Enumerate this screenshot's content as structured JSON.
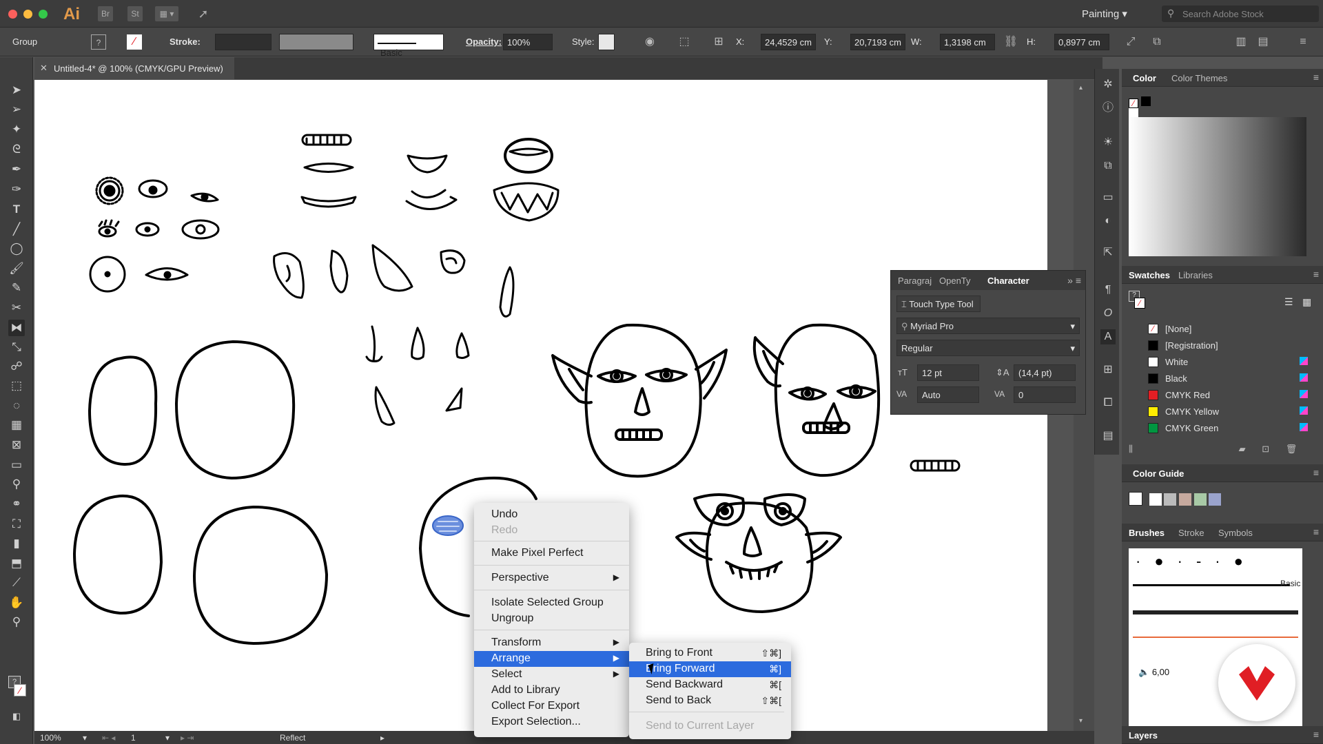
{
  "app": {
    "logo": "Ai",
    "workspace": "Painting",
    "search_placeholder": "Search Adobe Stock",
    "bridge_label": "Br",
    "stock_label": "St"
  },
  "controlbar": {
    "selection_type": "Group",
    "stroke_label": "Stroke:",
    "brush_label": "Basic",
    "opacity_label": "Opacity:",
    "opacity_value": "100%",
    "style_label": "Style:",
    "x_label": "X:",
    "x_value": "24,4529 cm",
    "y_label": "Y:",
    "y_value": "20,7193 cm",
    "w_label": "W:",
    "w_value": "1,3198 cm",
    "h_label": "H:",
    "h_value": "0,8977 cm"
  },
  "document": {
    "tab_title": "Untitled-4* @ 100% (CMYK/GPU Preview)"
  },
  "statusbar": {
    "zoom": "100%",
    "artboard": "1",
    "tool": "Reflect"
  },
  "character_panel": {
    "tabs": [
      "Paragraj",
      "OpenTy",
      "Character"
    ],
    "touch_type": "Touch Type Tool",
    "font_family": "Myriad Pro",
    "font_style": "Regular",
    "font_size": "12 pt",
    "leading": "(14,4 pt)",
    "kerning": "Auto",
    "tracking": "0"
  },
  "color_panel": {
    "tabs": [
      "Color",
      "Color Themes"
    ]
  },
  "swatches_panel": {
    "tabs": [
      "Swatches",
      "Libraries"
    ],
    "items": [
      {
        "name": "[None]",
        "color": "none"
      },
      {
        "name": "[Registration]",
        "color": "#000000"
      },
      {
        "name": "White",
        "color": "#ffffff"
      },
      {
        "name": "Black",
        "color": "#000000"
      },
      {
        "name": "CMYK Red",
        "color": "#e31e24"
      },
      {
        "name": "CMYK Yellow",
        "color": "#ffed00"
      },
      {
        "name": "CMYK Green",
        "color": "#009640"
      }
    ]
  },
  "color_guide": {
    "title": "Color Guide"
  },
  "brushes_panel": {
    "tabs": [
      "Brushes",
      "Stroke",
      "Symbols"
    ],
    "basic_label": "Basic",
    "size_value": "6,00"
  },
  "layers_panel": {
    "title": "Layers"
  },
  "context_menu": {
    "items": [
      {
        "label": "Undo",
        "enabled": true
      },
      {
        "label": "Redo",
        "enabled": false
      },
      {
        "label": "Make Pixel Perfect",
        "enabled": true
      },
      {
        "label": "Perspective",
        "enabled": true,
        "submenu": true
      },
      {
        "label": "Isolate Selected Group",
        "enabled": true
      },
      {
        "label": "Ungroup",
        "enabled": true
      },
      {
        "label": "Transform",
        "enabled": true,
        "submenu": true
      },
      {
        "label": "Arrange",
        "enabled": true,
        "submenu": true,
        "highlighted": true
      },
      {
        "label": "Select",
        "enabled": true,
        "submenu": true
      },
      {
        "label": "Add to Library",
        "enabled": true
      },
      {
        "label": "Collect For Export",
        "enabled": true
      },
      {
        "label": "Export Selection...",
        "enabled": true
      }
    ]
  },
  "arrange_submenu": {
    "items": [
      {
        "label": "Bring to Front",
        "shortcut": "⇧⌘]",
        "enabled": true
      },
      {
        "label": "Bring Forward",
        "shortcut": "⌘]",
        "enabled": true,
        "highlighted": true
      },
      {
        "label": "Send Backward",
        "shortcut": "⌘[",
        "enabled": true
      },
      {
        "label": "Send to Back",
        "shortcut": "⇧⌘[",
        "enabled": true
      },
      {
        "label": "Send to Current Layer",
        "shortcut": "",
        "enabled": false
      }
    ]
  },
  "colors": {
    "highlight": "#2c6bde",
    "accent_badge": "#e01e24"
  }
}
